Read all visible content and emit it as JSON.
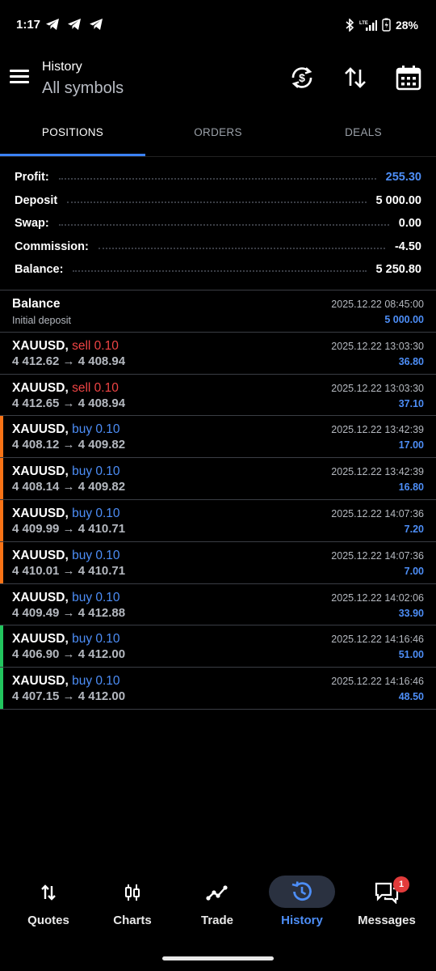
{
  "status_bar": {
    "time": "1:17",
    "battery": "28%"
  },
  "header": {
    "title": "History",
    "subtitle": "All symbols"
  },
  "tabs": [
    {
      "label": "POSITIONS",
      "active": true
    },
    {
      "label": "ORDERS",
      "active": false
    },
    {
      "label": "DEALS",
      "active": false
    }
  ],
  "summary": [
    {
      "label": "Profit:",
      "value": "255.30",
      "highlight": true
    },
    {
      "label": "Deposit",
      "value": "5 000.00",
      "highlight": false
    },
    {
      "label": "Swap:",
      "value": "0.00",
      "highlight": false
    },
    {
      "label": "Commission:",
      "value": "-4.50",
      "highlight": false
    },
    {
      "label": "Balance:",
      "value": "5 250.80",
      "highlight": false
    }
  ],
  "balance_entry": {
    "title": "Balance",
    "note": "Initial deposit",
    "date": "2025.12.22 08:45:00",
    "amount": "5 000.00"
  },
  "positions": [
    {
      "symbol": "XAUUSD,",
      "side": "sell 0.10",
      "type": "sell",
      "prices": "4 412.62 → 4 408.94",
      "date": "2025.12.22 13:03:30",
      "profit": "36.80",
      "marker": "none"
    },
    {
      "symbol": "XAUUSD,",
      "side": "sell 0.10",
      "type": "sell",
      "prices": "4 412.65 → 4 408.94",
      "date": "2025.12.22 13:03:30",
      "profit": "37.10",
      "marker": "none"
    },
    {
      "symbol": "XAUUSD,",
      "side": "buy 0.10",
      "type": "buy",
      "prices": "4 408.12 → 4 409.82",
      "date": "2025.12.22 13:42:39",
      "profit": "17.00",
      "marker": "orange"
    },
    {
      "symbol": "XAUUSD,",
      "side": "buy 0.10",
      "type": "buy",
      "prices": "4 408.14 → 4 409.82",
      "date": "2025.12.22 13:42:39",
      "profit": "16.80",
      "marker": "orange"
    },
    {
      "symbol": "XAUUSD,",
      "side": "buy 0.10",
      "type": "buy",
      "prices": "4 409.99 → 4 410.71",
      "date": "2025.12.22 14:07:36",
      "profit": "7.20",
      "marker": "orange"
    },
    {
      "symbol": "XAUUSD,",
      "side": "buy 0.10",
      "type": "buy",
      "prices": "4 410.01 → 4 410.71",
      "date": "2025.12.22 14:07:36",
      "profit": "7.00",
      "marker": "orange"
    },
    {
      "symbol": "XAUUSD,",
      "side": "buy 0.10",
      "type": "buy",
      "prices": "4 409.49 → 4 412.88",
      "date": "2025.12.22 14:02:06",
      "profit": "33.90",
      "marker": "none"
    },
    {
      "symbol": "XAUUSD,",
      "side": "buy 0.10",
      "type": "buy",
      "prices": "4 406.90 → 4 412.00",
      "date": "2025.12.22 14:16:46",
      "profit": "51.00",
      "marker": "green"
    },
    {
      "symbol": "XAUUSD,",
      "side": "buy 0.10",
      "type": "buy",
      "prices": "4 407.15 → 4 412.00",
      "date": "2025.12.22 14:16:46",
      "profit": "48.50",
      "marker": "green"
    }
  ],
  "nav": [
    {
      "label": "Quotes",
      "icon": "arrows-updown-icon",
      "active": false
    },
    {
      "label": "Charts",
      "icon": "candlestick-icon",
      "active": false
    },
    {
      "label": "Trade",
      "icon": "trend-line-icon",
      "active": false
    },
    {
      "label": "History",
      "icon": "history-clock-icon",
      "active": true
    },
    {
      "label": "Messages",
      "icon": "chat-bubbles-icon",
      "active": false,
      "badge": "1"
    }
  ],
  "colors": {
    "accent": "#4d8ef7",
    "sell": "#ef4444",
    "marker_orange": "#f97316",
    "marker_green": "#22c55e",
    "divider": "#3a3d44"
  }
}
